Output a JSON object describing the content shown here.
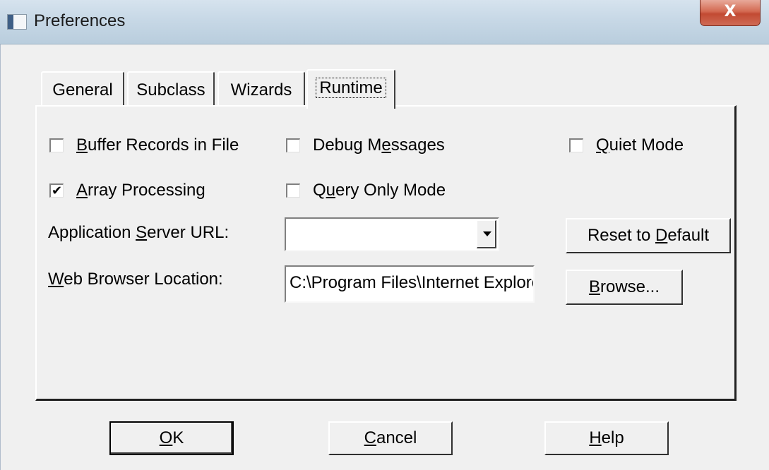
{
  "window": {
    "title": "Preferences",
    "close_label": "X"
  },
  "tabs": [
    {
      "label": "General"
    },
    {
      "label": "Subclass"
    },
    {
      "label": "Wizards"
    },
    {
      "label": "Runtime",
      "active": true
    }
  ],
  "checkboxes": {
    "buffer_records": {
      "pre": "",
      "key": "B",
      "post": "uffer Records in File",
      "checked": false
    },
    "debug_messages": {
      "pre": "Debug M",
      "key": "e",
      "post": "ssages",
      "checked": false
    },
    "quiet_mode": {
      "pre": "",
      "key": "Q",
      "post": "uiet Mode",
      "checked": false
    },
    "array_processing": {
      "pre": "",
      "key": "A",
      "post": "rray Processing",
      "checked": true,
      "mark": "✔"
    },
    "query_only_mode": {
      "pre": "Q",
      "key": "u",
      "post": "ery Only Mode",
      "checked": false
    }
  },
  "fields": {
    "app_server_url": {
      "pre": "Application ",
      "key": "S",
      "post": "erver URL:",
      "value": ""
    },
    "web_browser_location": {
      "pre": "",
      "key": "W",
      "post": "eb Browser Location:",
      "value": "C:\\Program Files\\Internet Explore"
    }
  },
  "buttons": {
    "reset": {
      "pre": "Reset to ",
      "key": "D",
      "post": "efault"
    },
    "browse": {
      "pre": "",
      "key": "B",
      "post": "rowse..."
    },
    "ok": {
      "pre": "",
      "key": "O",
      "post": "K"
    },
    "cancel": {
      "pre": "",
      "key": "C",
      "post": "ancel"
    },
    "help": {
      "pre": "",
      "key": "H",
      "post": "elp"
    }
  }
}
